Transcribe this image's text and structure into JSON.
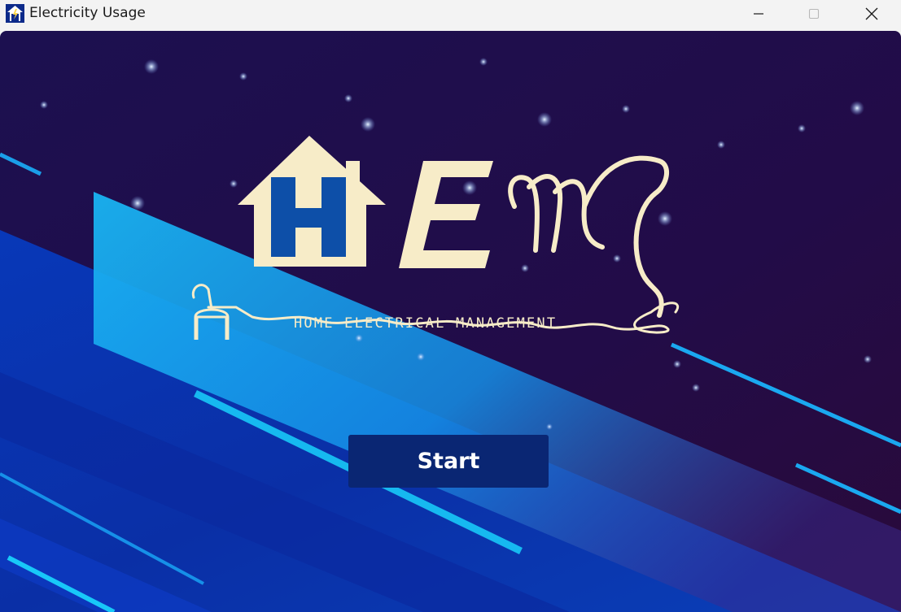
{
  "window": {
    "title": "Electricity Usage",
    "controls": {
      "minimize": "minimize-icon",
      "maximize": "maximize-icon",
      "close": "close-icon"
    }
  },
  "splash": {
    "logo_tagline": "HOME ELECTRICAL MANAGEMENT",
    "logo_letters": "HEM",
    "start_label": "Start"
  },
  "colors": {
    "background_dark": "#1f0e47",
    "stripe_blue": "#0a2fa6",
    "stripe_cyan": "#1aa8f0",
    "logo_cream": "#f7ecc8",
    "logo_h_blue": "#0d4fa8",
    "button_bg": "#0a2673",
    "button_text": "#ffffff"
  }
}
